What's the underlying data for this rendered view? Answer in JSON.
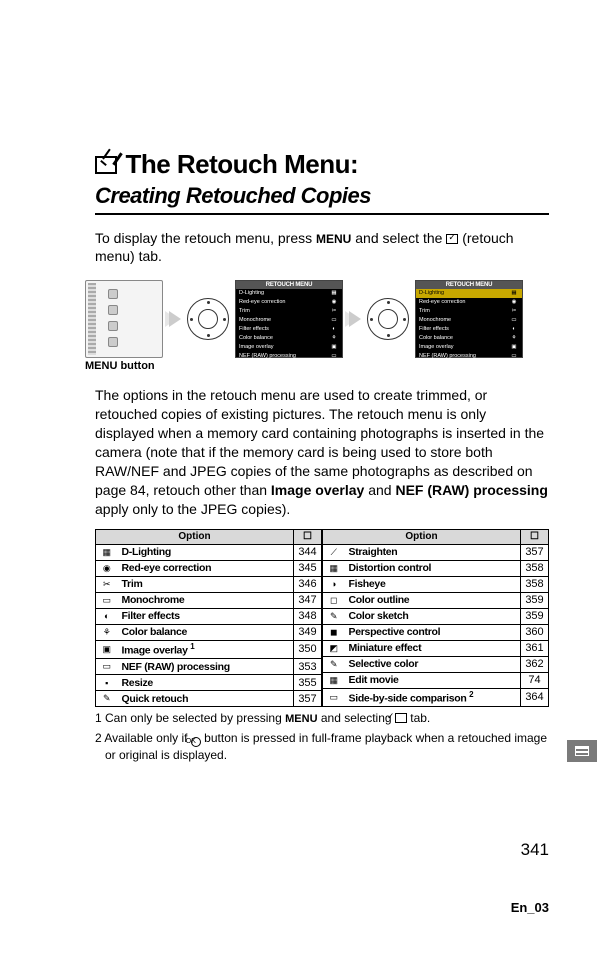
{
  "heading": {
    "title": "The Retouch Menu:",
    "subtitle": "Creating Retouched Copies"
  },
  "intro": {
    "part1": "To display the retouch menu, press ",
    "menu_word": "MENU",
    "part2": " and select the ",
    "part3": " (retouch menu) tab."
  },
  "figure": {
    "caption_menu": "MENU",
    "caption_rest": " button",
    "screen_title": "RETOUCH MENU",
    "screen1_rows": [
      {
        "label": "D-Lighting",
        "hl": false,
        "icon": "▦"
      },
      {
        "label": "Red-eye correction",
        "hl": false,
        "icon": "◉"
      },
      {
        "label": "Trim",
        "hl": false,
        "icon": "✂"
      },
      {
        "label": "Monochrome",
        "hl": false,
        "icon": "▭"
      },
      {
        "label": "Filter effects",
        "hl": false,
        "icon": "◐"
      },
      {
        "label": "Color balance",
        "hl": false,
        "icon": "⚘"
      },
      {
        "label": "Image overlay",
        "hl": false,
        "icon": "▣"
      },
      {
        "label": "NEF (RAW) processing",
        "hl": false,
        "icon": "▭"
      }
    ],
    "screen2_rows": [
      {
        "label": "D-Lighting",
        "hl": true,
        "icon": "▦"
      },
      {
        "label": "Red-eye correction",
        "hl": false,
        "icon": "◉"
      },
      {
        "label": "Trim",
        "hl": false,
        "icon": "✂"
      },
      {
        "label": "Monochrome",
        "hl": false,
        "icon": "▭"
      },
      {
        "label": "Filter effects",
        "hl": false,
        "icon": "◐"
      },
      {
        "label": "Color balance",
        "hl": false,
        "icon": "⚘"
      },
      {
        "label": "Image overlay",
        "hl": false,
        "icon": "▣"
      },
      {
        "label": "NEF (RAW) processing",
        "hl": false,
        "icon": "▭"
      }
    ]
  },
  "body": {
    "p1_a": "The options in the retouch menu are used to create trimmed, or retouched copies of existing pictures.  The retouch menu is only displayed when a memory card containing photographs is inserted in the camera (note that if the memory card is being used to store both RAW/NEF and JPEG copies of the same photographs as described on page 84, retouch other than ",
    "p1_b": "Image overlay",
    "p1_c": " and ",
    "p1_d": "NEF (RAW) processing",
    "p1_e": " apply only to the JPEG copies)."
  },
  "table_headers": {
    "option": "Option",
    "page_icon": "▭"
  },
  "table_left": [
    {
      "icon": "▦",
      "name": "D-Lighting",
      "page": "344"
    },
    {
      "icon": "◉",
      "name": "Red-eye correction",
      "page": "345"
    },
    {
      "icon": "✂",
      "name": "Trim",
      "page": "346"
    },
    {
      "icon": "▭",
      "name": "Monochrome",
      "page": "347"
    },
    {
      "icon": "◐",
      "name": "Filter effects",
      "page": "348"
    },
    {
      "icon": "⚘",
      "name": "Color balance",
      "page": "349"
    },
    {
      "icon": "▣",
      "name": "Image overlay ",
      "sup": "1",
      "page": "350"
    },
    {
      "icon": "▭",
      "name": "NEF (RAW) processing",
      "page": "353"
    },
    {
      "icon": "▪",
      "name": "Resize",
      "page": "355"
    },
    {
      "icon": "✎",
      "name": "Quick retouch",
      "page": "357"
    }
  ],
  "table_right": [
    {
      "icon": "⟋",
      "name": "Straighten",
      "page": "357"
    },
    {
      "icon": "▦",
      "name": "Distortion control",
      "page": "358"
    },
    {
      "icon": "◑",
      "name": "Fisheye",
      "page": "358"
    },
    {
      "icon": "◻",
      "name": "Color outline",
      "page": "359"
    },
    {
      "icon": "✎",
      "name": "Color sketch",
      "page": "359"
    },
    {
      "icon": "◼",
      "name": "Perspective control",
      "page": "360"
    },
    {
      "icon": "◩",
      "name": "Miniature effect",
      "page": "361"
    },
    {
      "icon": "✎",
      "name": "Selective color",
      "page": "362"
    },
    {
      "icon": "▦",
      "name": "Edit movie",
      "page": "74"
    },
    {
      "icon": "▭",
      "name": "Side-by-side comparison ",
      "sup": "2",
      "page": "364"
    }
  ],
  "footnotes": {
    "f1_a": "1 Can only be selected by pressing ",
    "f1_menu": "MENU",
    "f1_b": " and selecting ",
    "f1_c": " tab.",
    "f2_a": "2 Available only if ",
    "f2_b": " button is pressed in full-frame playback when a retouched image or original is displayed.",
    "ok_label": "OK"
  },
  "page_number": "341",
  "doc_id": "En_03"
}
